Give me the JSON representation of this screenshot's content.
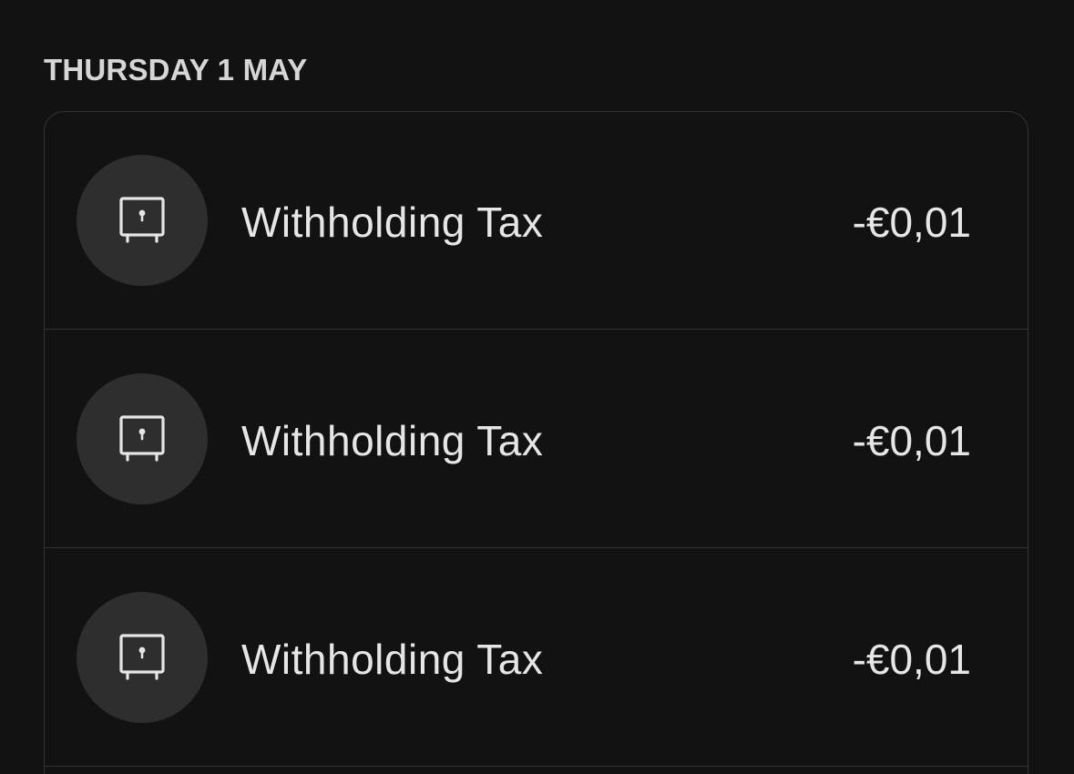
{
  "date_header": "THURSDAY 1 MAY",
  "transactions": [
    {
      "title": "Withholding Tax",
      "amount": "-€0,01",
      "icon": "safe-icon"
    },
    {
      "title": "Withholding Tax",
      "amount": "-€0,01",
      "icon": "safe-icon"
    },
    {
      "title": "Withholding Tax",
      "amount": "-€0,01",
      "icon": "safe-icon"
    }
  ],
  "colors": {
    "background": "#121212",
    "icon_circle": "#2e2e2e",
    "border": "#333333",
    "text": "#e6e6e6"
  }
}
